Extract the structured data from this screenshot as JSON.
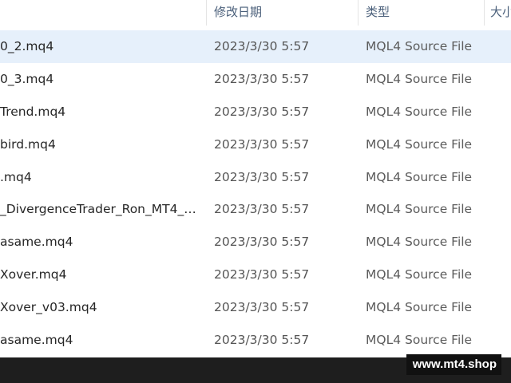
{
  "header": {
    "columns": [
      {
        "label": "修改日期"
      },
      {
        "label": "类型"
      },
      {
        "label": "大小"
      }
    ],
    "sort_indicator": "chevron-up-icon"
  },
  "files": [
    {
      "name": "0_2.mq4",
      "date": "2023/3/30 5:57",
      "type": "MQL4 Source File",
      "selected": true
    },
    {
      "name": "0_3.mq4",
      "date": "2023/3/30 5:57",
      "type": "MQL4 Source File"
    },
    {
      "name": "Trend.mq4",
      "date": "2023/3/30 5:57",
      "type": "MQL4 Source File"
    },
    {
      "name": "bird.mq4",
      "date": "2023/3/30 5:57",
      "type": "MQL4 Source File"
    },
    {
      "name": ".mq4",
      "date": "2023/3/30 5:57",
      "type": "MQL4 Source File"
    },
    {
      "name": "_DivergenceTrader_Ron_MT4_v...",
      "date": "2023/3/30 5:57",
      "type": "MQL4 Source File"
    },
    {
      "name": "asame.mq4",
      "date": "2023/3/30 5:57",
      "type": "MQL4 Source File"
    },
    {
      "name": "Xover.mq4",
      "date": "2023/3/30 5:57",
      "type": "MQL4 Source File"
    },
    {
      "name": "Xover_v03.mq4",
      "date": "2023/3/30 5:57",
      "type": "MQL4 Source File"
    },
    {
      "name": "asame.mq4",
      "date": "2023/3/30 5:57",
      "type": "MQL4 Source File"
    }
  ],
  "watermark": "www.mt4.shop",
  "colors": {
    "selected_row": "#e6f0fb",
    "header_text": "#4a5f7a",
    "taskbar": "#1e1e1e"
  }
}
